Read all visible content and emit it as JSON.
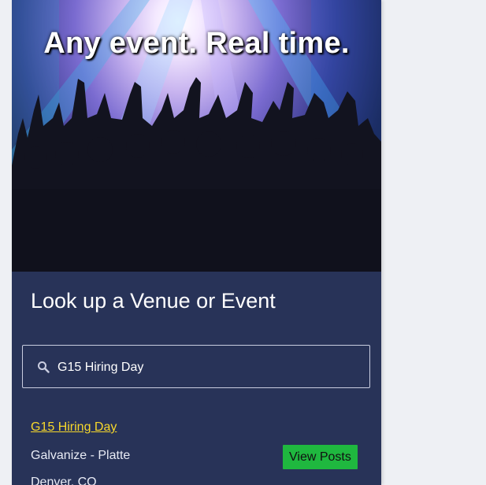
{
  "hero": {
    "tagline": "Any event. Real time."
  },
  "search": {
    "title": "Look up a Venue or Event",
    "query": "G15 Hiring Day",
    "icon": "search-icon"
  },
  "results": [
    {
      "event_name": "G15 Hiring Day",
      "venue": "Galvanize - Platte",
      "city": "Denver, CO",
      "action_label": "View Posts"
    }
  ],
  "colors": {
    "panel_bg": "#283358",
    "link": "#f7d82b",
    "button_bg": "#1fb83f",
    "page_bg": "#eef0f4"
  }
}
